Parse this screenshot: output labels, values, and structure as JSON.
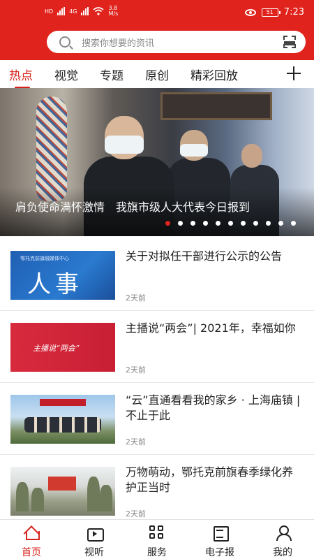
{
  "status_bar": {
    "network_left": "HD",
    "network_top": "4G",
    "speed_value": "3.8",
    "speed_unit": "M/s",
    "battery": "51",
    "time": "7:23"
  },
  "search": {
    "placeholder": "搜索你想要的资讯"
  },
  "tabs": [
    {
      "label": "热点",
      "active": true
    },
    {
      "label": "视觉",
      "active": false
    },
    {
      "label": "专题",
      "active": false
    },
    {
      "label": "原创",
      "active": false
    },
    {
      "label": "精彩回放",
      "active": false
    }
  ],
  "banner": {
    "caption": "肩负使命满怀激情　我旗市级人大代表今日报到",
    "slide_count": 11,
    "active_slide": 1
  },
  "news": [
    {
      "title": "关于对拟任干部进行公示的公告",
      "time": "2天前",
      "thumb_text": "人事",
      "thumb_org": "鄂托克前旗融媒体中心"
    },
    {
      "title": "主播说“两会”| 2021年，幸福如你",
      "time": "2天前",
      "thumb_text": "主播说“两会”"
    },
    {
      "title": "“云”直通看看我的家乡 · 上海庙镇 | 不止于此",
      "time": "2天前"
    },
    {
      "title": "万物萌动，鄂托克前旗春季绿化养护正当时",
      "time": "2天前"
    }
  ],
  "bottom_nav": [
    {
      "label": "首页",
      "icon": "home-icon",
      "active": true
    },
    {
      "label": "视听",
      "icon": "video-icon",
      "active": false
    },
    {
      "label": "服务",
      "icon": "grid-icon",
      "active": false
    },
    {
      "label": "电子报",
      "icon": "newspaper-icon",
      "active": false
    },
    {
      "label": "我的",
      "icon": "user-icon",
      "active": false
    }
  ],
  "colors": {
    "brand_red": "#e0231c",
    "active_text": "#d8231c"
  }
}
